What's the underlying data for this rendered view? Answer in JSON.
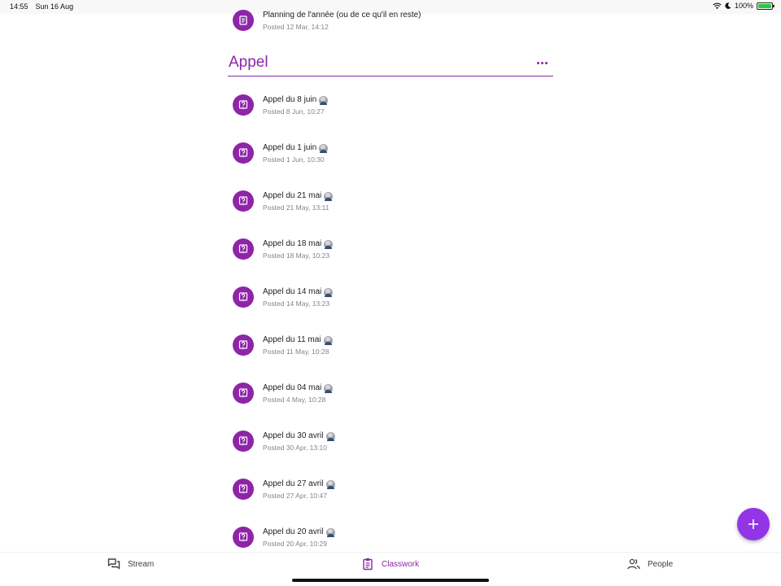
{
  "status_bar": {
    "time": "14:55",
    "date": "Sun 16 Aug",
    "battery": "100%"
  },
  "previous_item": {
    "title": "Planning de l'année (ou de ce qu'il en reste)",
    "posted": "Posted 12 Mar, 14:12"
  },
  "topic": {
    "title": "Appel"
  },
  "items": [
    {
      "title": "Appel du 8 juin",
      "posted": "Posted 8 Jun, 10:27"
    },
    {
      "title": "Appel du 1 juin",
      "posted": "Posted 1 Jun, 10:30"
    },
    {
      "title": "Appel du 21 mai",
      "posted": "Posted 21 May, 13:11"
    },
    {
      "title": "Appel du 18 mai",
      "posted": "Posted 18 May, 10:23"
    },
    {
      "title": "Appel du 14 mai",
      "posted": "Posted 14 May, 13:23"
    },
    {
      "title": "Appel du 11 mai",
      "posted": "Posted 11 May, 10:28"
    },
    {
      "title": "Appel du 04 mai",
      "posted": "Posted 4 May, 10:28"
    },
    {
      "title": "Appel du 30 avril",
      "posted": "Posted 30 Apr, 13:10"
    },
    {
      "title": "Appel du 27 avril",
      "posted": "Posted 27 Apr, 10:47"
    },
    {
      "title": "Appel du 20 avril",
      "posted": "Posted 20 Apr, 10:29"
    }
  ],
  "bottom_nav": {
    "stream": "Stream",
    "classwork": "Classwork",
    "people": "People"
  },
  "colors": {
    "accent": "#8e24aa",
    "fab": "#9334e6",
    "subtext": "#80868b"
  },
  "icons": {
    "question": "question-icon",
    "material": "material-icon",
    "add": "add-icon"
  }
}
